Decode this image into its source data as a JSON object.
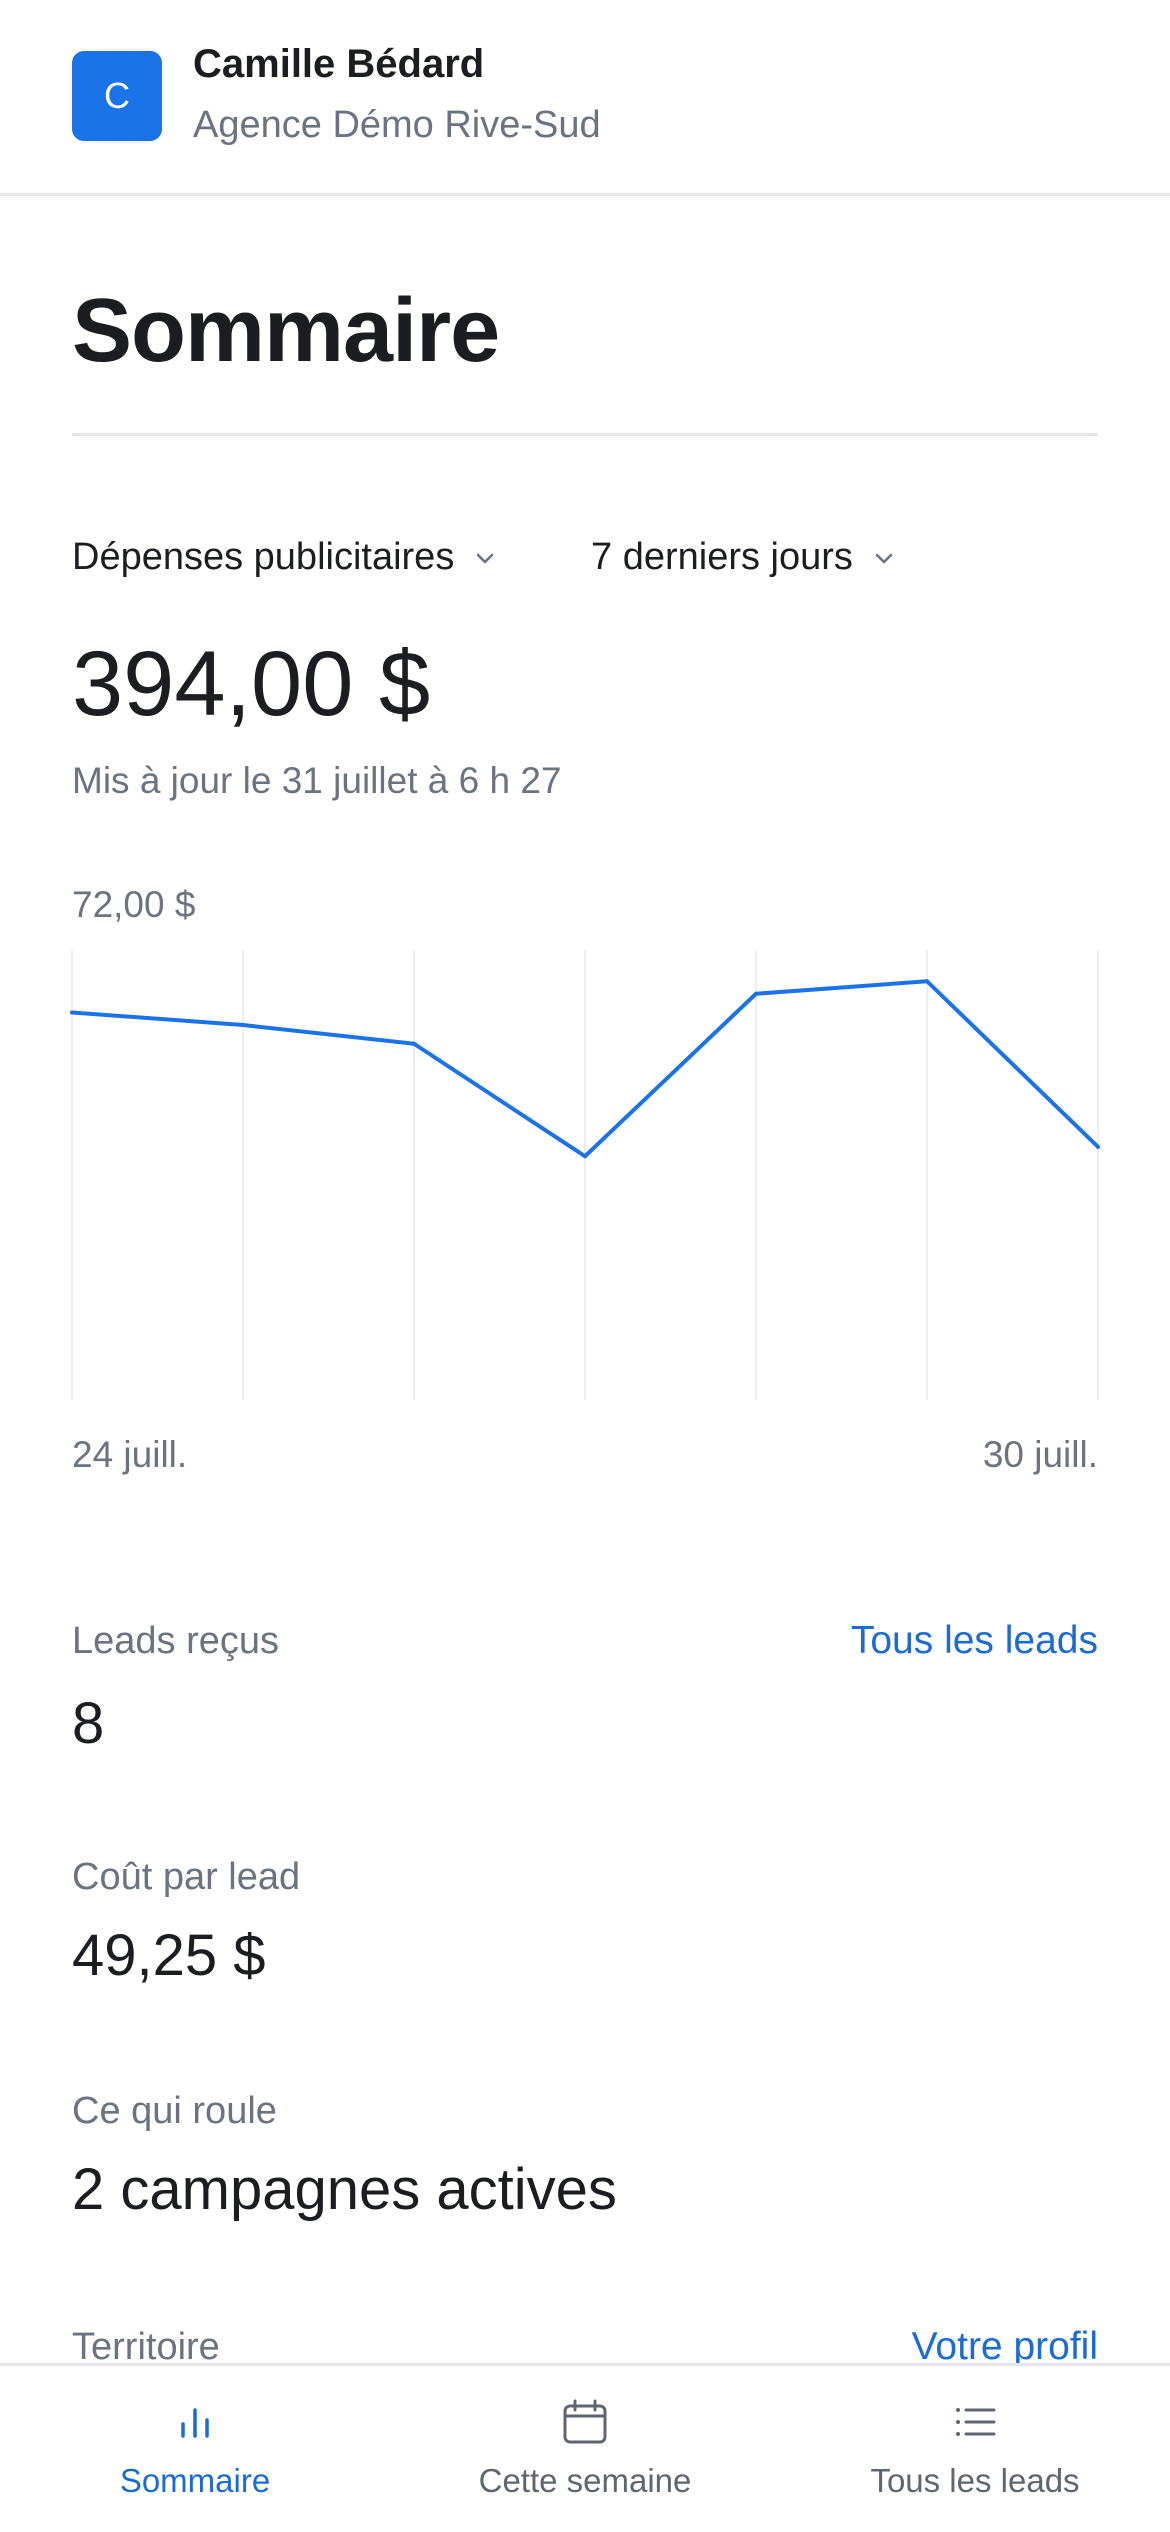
{
  "header": {
    "avatar_initial": "C",
    "user_name": "Camille Bédard",
    "agency_name": "Agence Démo Rive-Sud"
  },
  "page_title": "Sommaire",
  "filters": {
    "metric_label": "Dépenses publicitaires",
    "period_label": "7 derniers jours"
  },
  "summary": {
    "total_value": "394,00 $",
    "updated_text": "Mis à jour le 31 juillet à 6 h 27"
  },
  "chart_data": {
    "type": "line",
    "y_max_label": "72,00 $",
    "ylim": [
      0,
      72
    ],
    "x_start_label": "24 juill.",
    "x_end_label": "30 juill.",
    "x": [
      "24 juill.",
      "25 juill.",
      "26 juill.",
      "27 juill.",
      "28 juill.",
      "29 juill.",
      "30 juill."
    ],
    "series": [
      {
        "values": [
          62,
          60,
          57,
          39,
          65,
          67,
          40.5
        ]
      }
    ],
    "grid": "vertical",
    "line_color": "#1a73e8"
  },
  "stats": {
    "leads_label": "Leads reçus",
    "leads_link": "Tous les leads",
    "leads_value": "8",
    "cpl_label": "Coût par lead",
    "cpl_value": "49,25 $",
    "running_label": "Ce qui roule",
    "running_value": "2 campagnes actives",
    "territory_label": "Territoire",
    "territory_link": "Votre profil"
  },
  "bottom_nav": {
    "items": [
      {
        "label": "Sommaire",
        "icon": "bar-chart-icon",
        "active": true
      },
      {
        "label": "Cette semaine",
        "icon": "calendar-icon",
        "active": false
      },
      {
        "label": "Tous les leads",
        "icon": "list-icon",
        "active": false
      }
    ]
  },
  "colors": {
    "accent": "#1a73e8",
    "link": "#1a6bd6",
    "muted_text": "#6b7280",
    "divider": "#e4e6ea"
  }
}
